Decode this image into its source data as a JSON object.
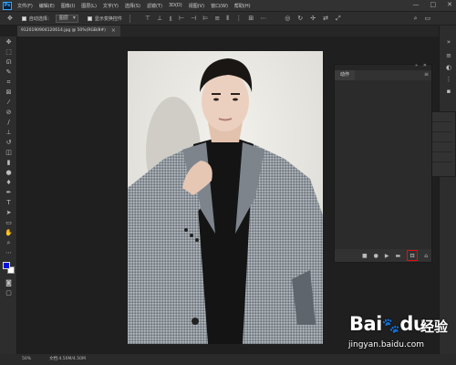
{
  "app": {
    "logo": "Ps",
    "menu": [
      "文件(F)",
      "编辑(E)",
      "图像(I)",
      "图层(L)",
      "文字(Y)",
      "选择(S)",
      "滤镜(T)",
      "3D(D)",
      "视图(V)",
      "窗口(W)",
      "帮助(H)"
    ],
    "window_controls": [
      "—",
      "□",
      "✕"
    ]
  },
  "options": {
    "move_icon": "move-icon",
    "auto_select_label": "自动选择：",
    "auto_select_value": "图层",
    "show_transform_label": "显示变换控件"
  },
  "document": {
    "tab_title": "9120190904120614.jpg @ 50%(RGB/8#)",
    "zoom": "50%",
    "doc_size": "文档:4.50M/4.50M"
  },
  "colors": {
    "foreground": "#0012d8",
    "background": "#ffffff",
    "highlight": "#e01010"
  },
  "actions_panel": {
    "tab_label": "动作",
    "bottom_icons": [
      "stop-icon",
      "record-icon",
      "play-icon",
      "folder-icon",
      "new-action-icon",
      "trash-icon"
    ]
  },
  "watermark": {
    "brand": "Bai",
    "brand2": "du",
    "cn": "经验",
    "url": "jingyan.baidu.com"
  }
}
